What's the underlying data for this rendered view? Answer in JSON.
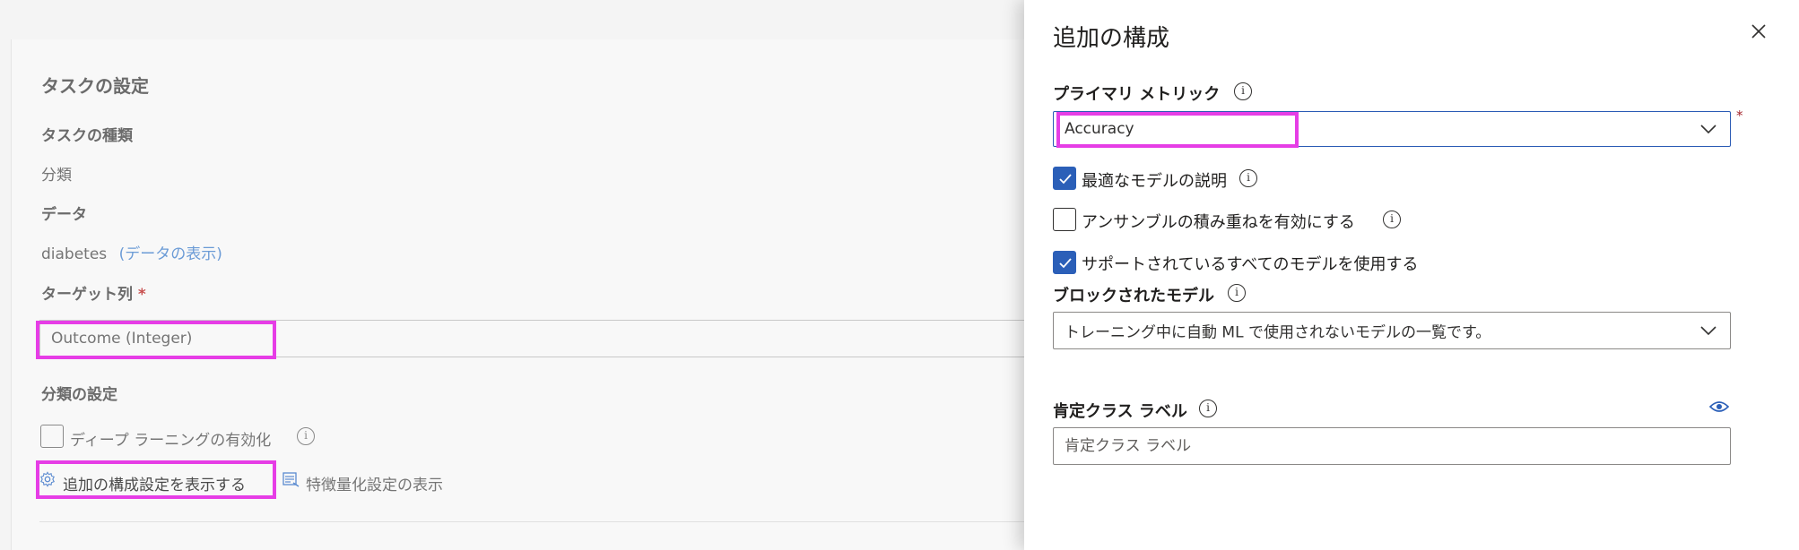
{
  "background": {
    "section_title": "タスクの設定",
    "task_type_label": "タスクの種類",
    "task_type_value": "分類",
    "data_label": "データ",
    "data_value": "diabetes",
    "data_link": "(データの表示)",
    "target_label": "ターゲット列",
    "required_mark": "*",
    "target_value": "Outcome (Integer)",
    "classification_settings_label": "分類の設定",
    "deep_learning_label": "ディープ ラーニングの有効化",
    "deep_learning_checked": false,
    "additional_config_link": "追加の構成設定を表示する",
    "featurization_link": "特徴量化設定の表示"
  },
  "panel": {
    "title": "追加の構成",
    "close_icon": "close-icon",
    "primary_metric_label": "プライマリ メトリック",
    "primary_metric_value": "Accuracy",
    "required_mark": "*",
    "checkboxes": [
      {
        "label": "最適なモデルの説明",
        "checked": true
      },
      {
        "label": "アンサンブルの積み重ねを有効にする",
        "checked": false
      },
      {
        "label": "サポートされているすべてのモデルを使用する",
        "checked": true
      }
    ],
    "blocked_models_label": "ブロックされたモデル",
    "blocked_models_placeholder": "トレーニング中に自動 ML で使用されないモデルの一覧です。",
    "positive_class_label": "肯定クラス ラベル",
    "positive_class_placeholder": "肯定クラス ラベル"
  },
  "colors": {
    "accent": "#2b5fb8",
    "highlight": "#e63de6",
    "required": "#a4262c"
  }
}
